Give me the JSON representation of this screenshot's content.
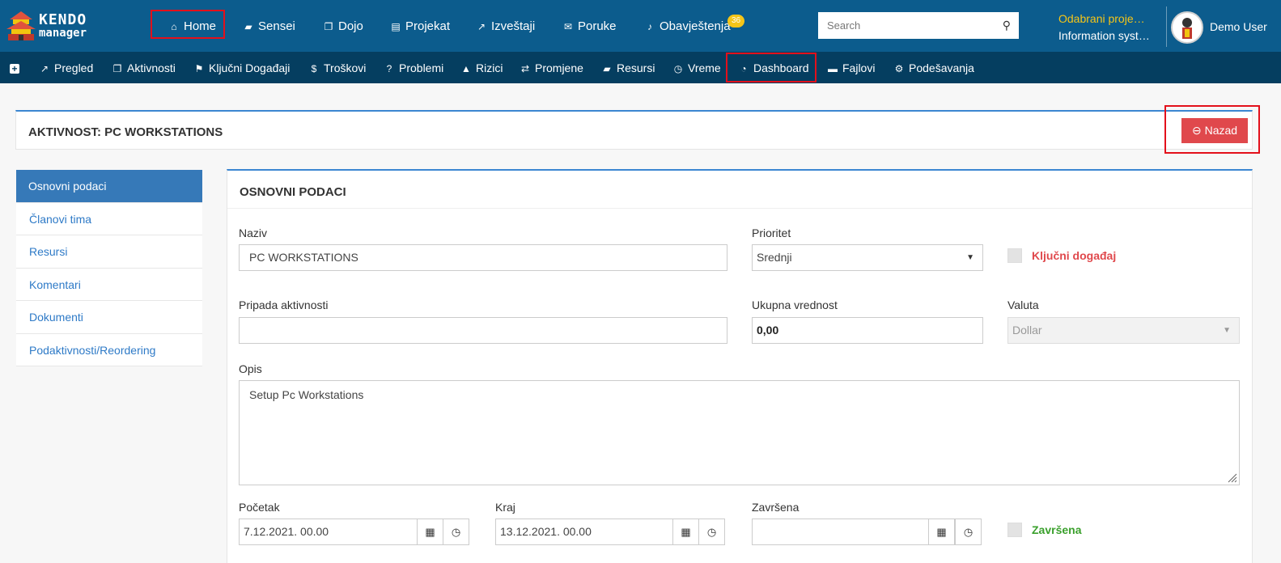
{
  "brand": {
    "line1": "KENDO",
    "line2": "manager"
  },
  "topnav": {
    "home": "Home",
    "sensei": "Sensei",
    "dojo": "Dojo",
    "projekat": "Projekat",
    "izvestaji": "Izveštaji",
    "poruke": "Poruke",
    "obavjestenja": "Obavještenja",
    "obavjestenja_count": "36",
    "search_placeholder": "Search",
    "project_label": "Odabrani proje…",
    "project_name": "Information syst…",
    "user": "Demo User"
  },
  "subnav": {
    "add": "+",
    "pregled": "Pregled",
    "aktivnosti": "Aktivnosti",
    "kljucni": "Ključni Događaji",
    "troskovi": "Troškovi",
    "problemi": "Problemi",
    "rizici": "Rizici",
    "promjene": "Promjene",
    "resursi": "Resursi",
    "vreme": "Vreme",
    "dashboard": "Dashboard",
    "fajlovi": "Fajlovi",
    "podesavanja": "Podešavanja"
  },
  "header": {
    "title": "AKTIVNOST: PC WORKSTATIONS",
    "back_button": "Nazad"
  },
  "sidebar": {
    "items": [
      {
        "label": "Osnovni podaci"
      },
      {
        "label": "Članovi tima"
      },
      {
        "label": "Resursi"
      },
      {
        "label": "Komentari"
      },
      {
        "label": "Dokumenti"
      },
      {
        "label": "Podaktivnosti/Reordering"
      }
    ]
  },
  "form": {
    "title": "OSNOVNI PODACI",
    "naziv_label": "Naziv",
    "naziv_value": "PC WORKSTATIONS",
    "prioritet_label": "Prioritet",
    "prioritet_value": "Srednji",
    "kljucni_label": "Ključni događaj",
    "pripada_label": "Pripada aktivnosti",
    "pripada_value": "",
    "ukupna_label": "Ukupna vrednost",
    "ukupna_value": "0,00",
    "valuta_label": "Valuta",
    "valuta_value": "Dollar",
    "opis_label": "Opis",
    "opis_value": "Setup Pc Workstations",
    "pocetak_label": "Početak",
    "pocetak_value": "7.12.2021. 00.00",
    "kraj_label": "Kraj",
    "kraj_value": "13.12.2021. 00.00",
    "zavrsena_label": "Završena",
    "zavrsena_value": "",
    "zavrsena_chk_label": "Završena"
  },
  "colors": {
    "topnav_bg": "#0c5c8d",
    "subnav_bg": "#053e60",
    "accent": "#3679b8",
    "back_button": "#e0484c",
    "highlight": "#e3101b",
    "project_label": "#f5c518",
    "kljucni_label": "#e0484c",
    "zavrsena_label": "#3aa02c"
  }
}
